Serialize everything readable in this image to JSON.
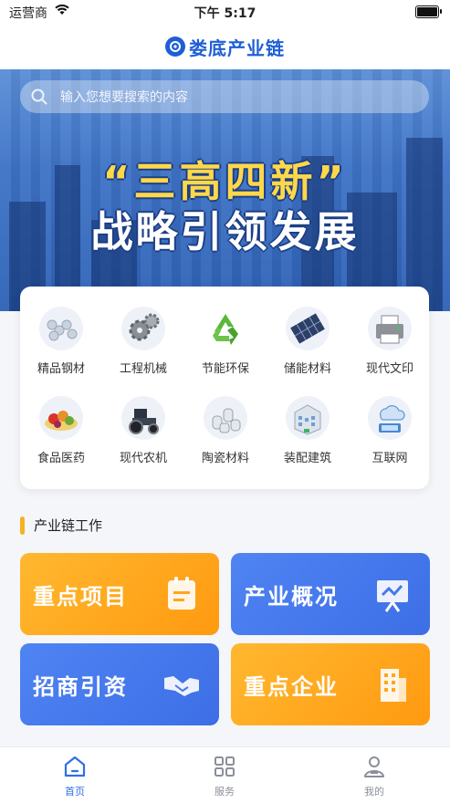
{
  "status": {
    "carrier": "运营商",
    "time": "下午 5:17"
  },
  "header": {
    "logo_text": "娄底产业链"
  },
  "search": {
    "placeholder": "输入您想要搜索的内容"
  },
  "banner": {
    "line1": "“三高四新”",
    "line2": "战略引领发展"
  },
  "categories": [
    {
      "label": "精品钢材",
      "icon": "steel-pipes-icon"
    },
    {
      "label": "工程机械",
      "icon": "gears-icon"
    },
    {
      "label": "节能环保",
      "icon": "recycle-icon"
    },
    {
      "label": "储能材料",
      "icon": "solar-panel-icon"
    },
    {
      "label": "现代文印",
      "icon": "printer-icon"
    },
    {
      "label": "食品医药",
      "icon": "food-icon"
    },
    {
      "label": "现代农机",
      "icon": "tractor-icon"
    },
    {
      "label": "陶瓷材料",
      "icon": "ceramics-icon"
    },
    {
      "label": "装配建筑",
      "icon": "building-icon"
    },
    {
      "label": "互联网",
      "icon": "internet-icon"
    }
  ],
  "section": {
    "title": "产业链工作"
  },
  "cards": [
    {
      "label": "重点项目",
      "icon": "clipboard-icon",
      "color": "#ffa61c"
    },
    {
      "label": "产业概况",
      "icon": "presentation-icon",
      "color": "#4677ec"
    },
    {
      "label": "招商引资",
      "icon": "handshake-icon",
      "color": "#4677ec"
    },
    {
      "label": "重点企业",
      "icon": "office-building-icon",
      "color": "#ffa61c"
    }
  ],
  "tabs": [
    {
      "label": "首页",
      "icon": "home-icon",
      "active": true
    },
    {
      "label": "服务",
      "icon": "grid-icon",
      "active": false
    },
    {
      "label": "我的",
      "icon": "user-icon",
      "active": false
    }
  ],
  "colors": {
    "accent": "#2e6fe6",
    "orange": "#ffa61c",
    "section_bar": "#f5b320"
  }
}
